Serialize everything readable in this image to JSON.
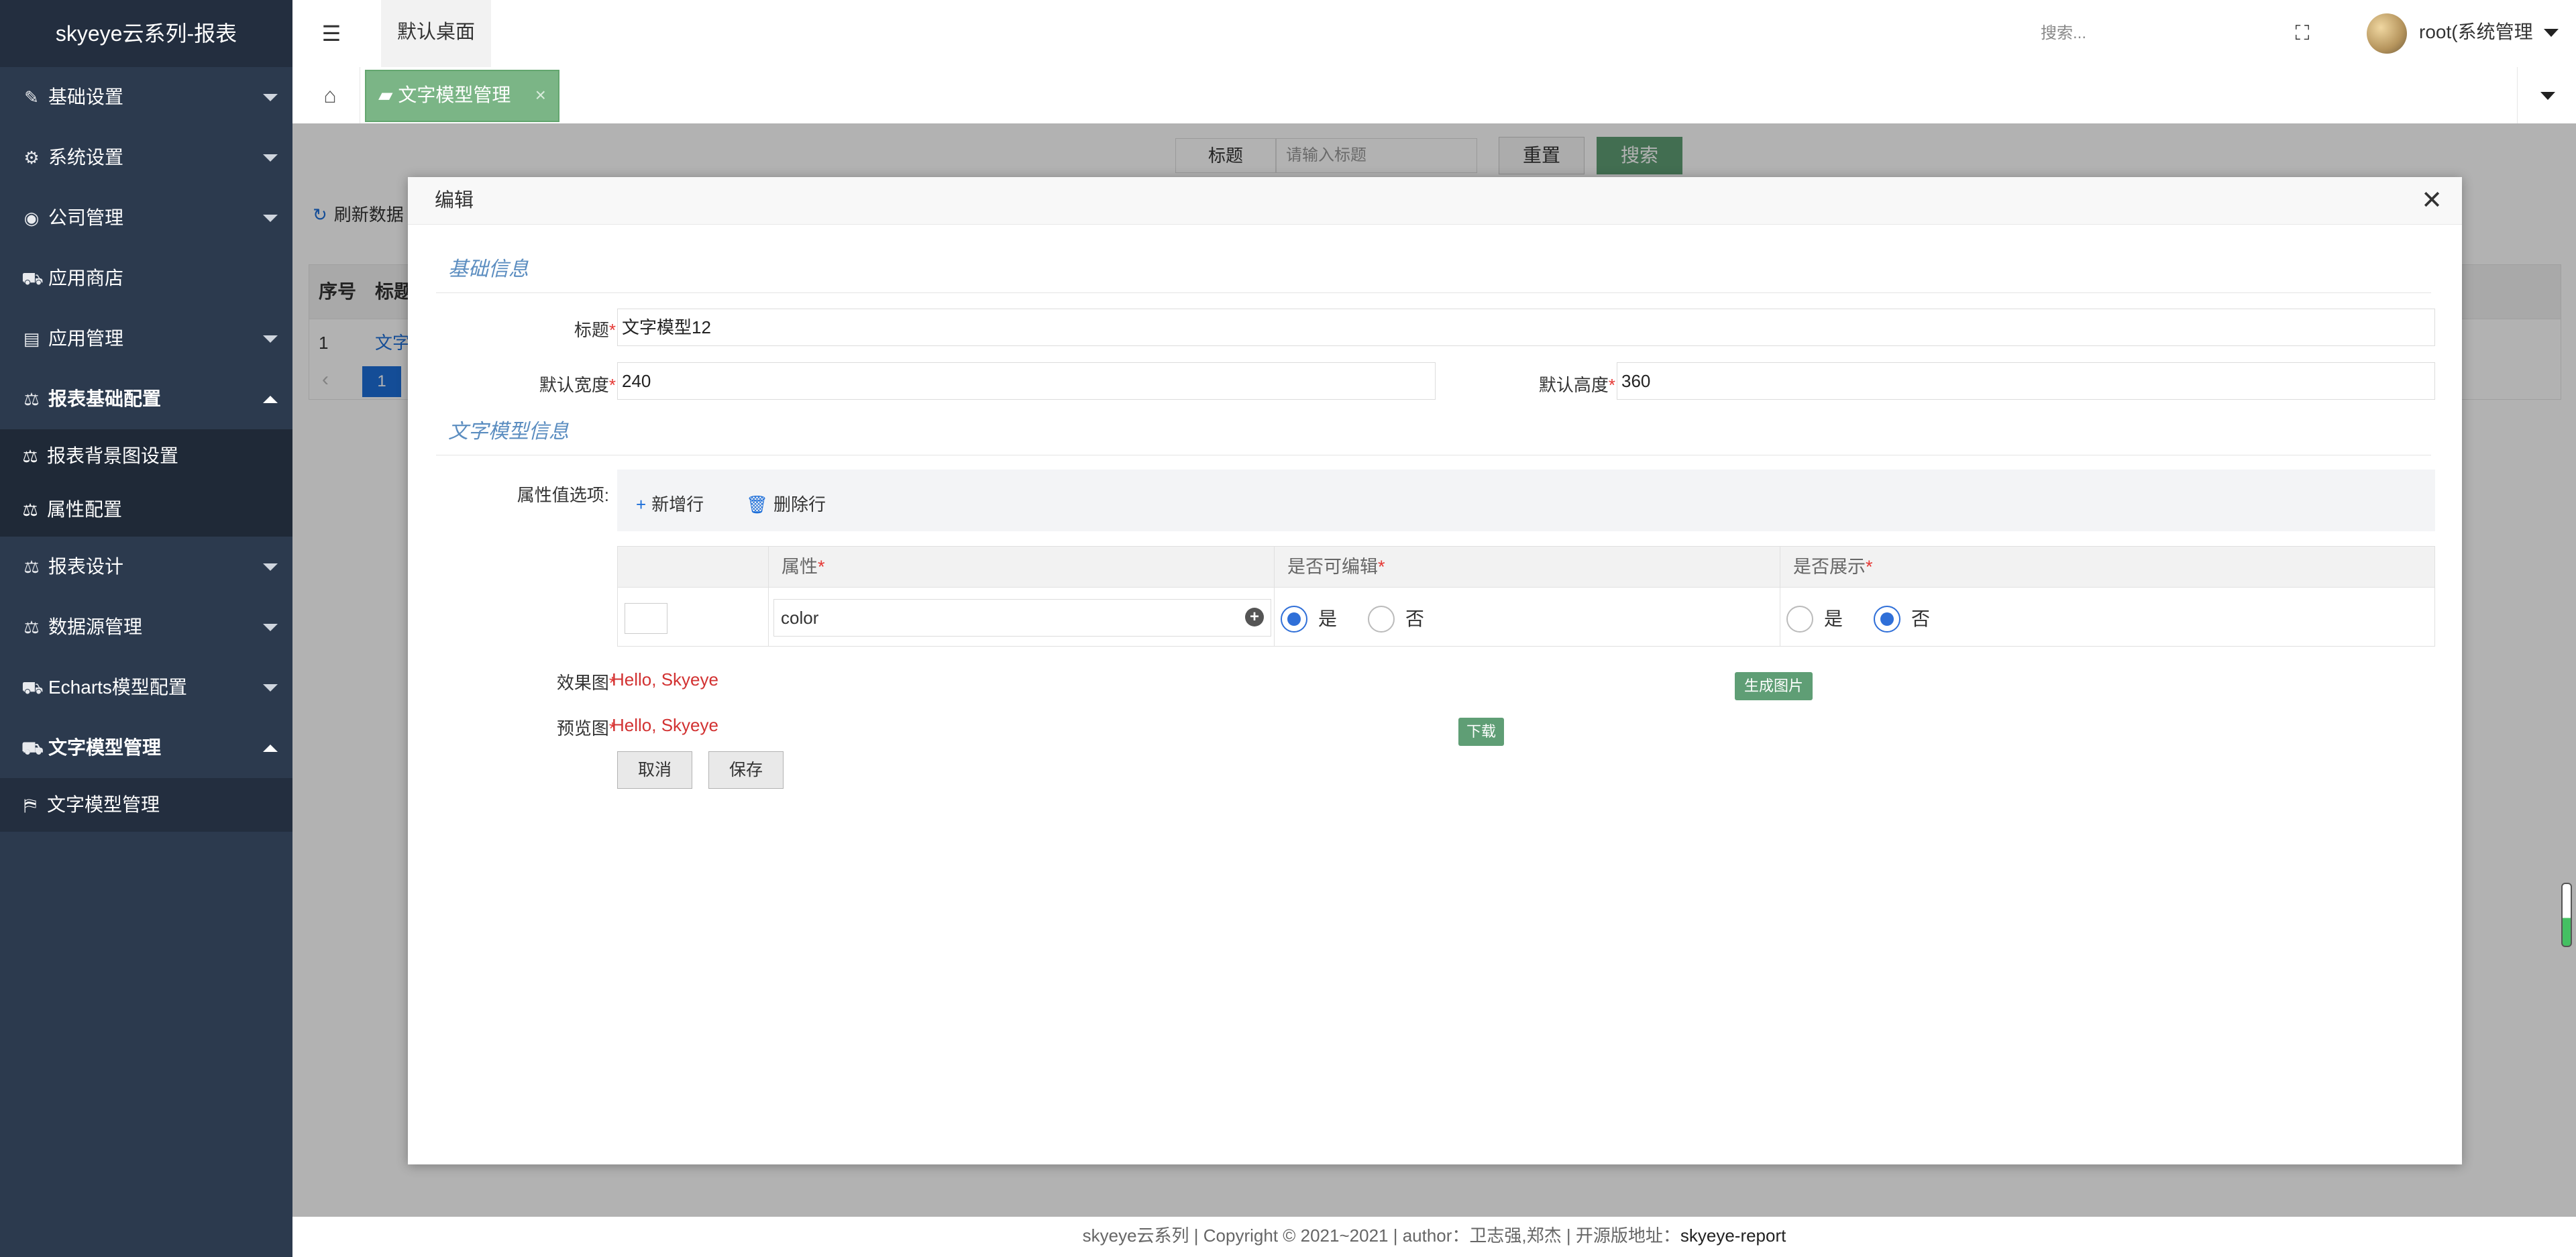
{
  "app": {
    "title": "skyeye云系列-报表"
  },
  "sidebar": {
    "items": [
      {
        "label": "基础设置",
        "icon": "✎"
      },
      {
        "label": "系统设置",
        "icon": "⚙"
      },
      {
        "label": "公司管理",
        "icon": "◉"
      },
      {
        "label": "应用商店",
        "icon": "⛟"
      },
      {
        "label": "应用管理",
        "icon": "▤"
      },
      {
        "label": "报表基础配置",
        "icon": "⚖"
      },
      {
        "label": "报表背景图设置",
        "icon": "⚖"
      },
      {
        "label": "属性配置",
        "icon": "⚖"
      },
      {
        "label": "报表设计",
        "icon": "⚖"
      },
      {
        "label": "数据源管理",
        "icon": "⚖"
      },
      {
        "label": "Echarts模型配置",
        "icon": "⛟"
      },
      {
        "label": "文字模型管理",
        "icon": "⛟"
      },
      {
        "label": "文字模型管理",
        "icon": "⛿"
      }
    ]
  },
  "header": {
    "desk_tab": "默认桌面",
    "search_placeholder": "搜索...",
    "user": "root(系统管理"
  },
  "tabs": {
    "open_tab": "文字模型管理",
    "close": "×"
  },
  "background": {
    "search_label": "标题",
    "search_placeholder": "请输入标题",
    "reset": "重置",
    "search": "搜索",
    "refresh": "刷新数据",
    "col_index": "序号",
    "col_title": "标题",
    "row_index": "1",
    "row_title": "文字",
    "page": "1"
  },
  "modal": {
    "title": "编辑",
    "basic_legend": "基础信息",
    "title_label": "标题",
    "title_value": "文字模型12",
    "width_label": "默认宽度",
    "width_value": "240",
    "height_label": "默认高度",
    "height_value": "360",
    "text_legend": "文字模型信息",
    "attr_label": "属性值选项:",
    "add_row": "新增行",
    "delete_row": "删除行",
    "grid": {
      "col_attr": "属性",
      "col_editable": "是否可编辑",
      "col_show": "是否展示",
      "row": {
        "attr_value": "color",
        "editable_yes": "是",
        "editable_no": "否",
        "show_yes": "是",
        "show_no": "否",
        "editable": "是",
        "show": "否"
      }
    },
    "effect_label": "效果图",
    "effect_value": "Hello, Skyeye",
    "generate_btn": "生成图片",
    "preview_label": "预览图",
    "preview_value": "Hello, Skyeye",
    "download_btn": "下载",
    "cancel": "取消",
    "save": "保存"
  },
  "footer": {
    "text": "skyeye云系列 | Copyright © 2021~2021 | author：卫志强,郑杰 | 开源版地址：",
    "project": "skyeye-report"
  },
  "colors": {
    "sidebar": "#2c3a4e",
    "accent_green": "#5f9e75",
    "tab_green": "#7bb586",
    "link_blue": "#1e6fd9",
    "required_red": "#e53935"
  }
}
